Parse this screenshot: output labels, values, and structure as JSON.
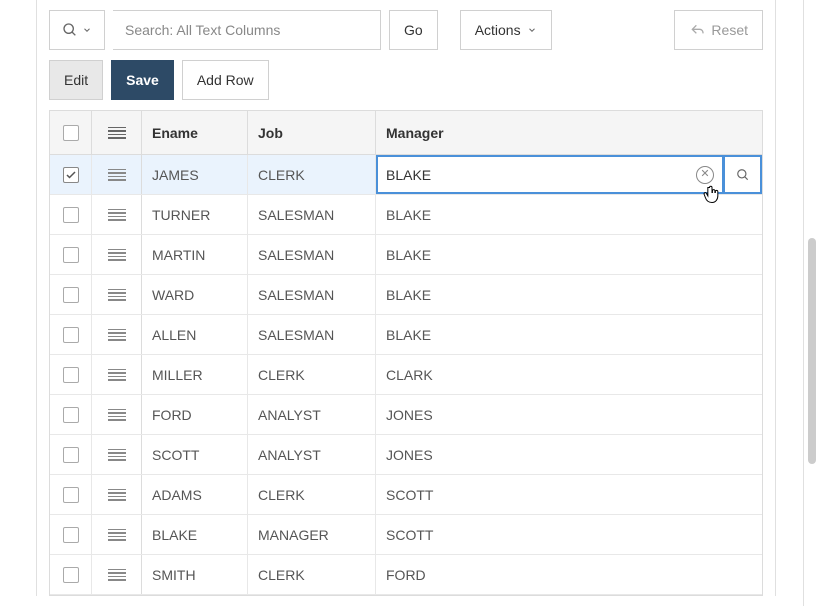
{
  "toolbar": {
    "search_placeholder": "Search: All Text Columns",
    "go_label": "Go",
    "actions_label": "Actions",
    "reset_label": "Reset",
    "edit_label": "Edit",
    "save_label": "Save",
    "add_row_label": "Add Row"
  },
  "columns": {
    "ename": "Ename",
    "job": "Job",
    "manager": "Manager"
  },
  "editor": {
    "value": "BLAKE"
  },
  "rows": [
    {
      "ename": "JAMES",
      "job": "CLERK",
      "manager": "BLAKE",
      "selected": true
    },
    {
      "ename": "TURNER",
      "job": "SALESMAN",
      "manager": "BLAKE",
      "selected": false
    },
    {
      "ename": "MARTIN",
      "job": "SALESMAN",
      "manager": "BLAKE",
      "selected": false
    },
    {
      "ename": "WARD",
      "job": "SALESMAN",
      "manager": "BLAKE",
      "selected": false
    },
    {
      "ename": "ALLEN",
      "job": "SALESMAN",
      "manager": "BLAKE",
      "selected": false
    },
    {
      "ename": "MILLER",
      "job": "CLERK",
      "manager": "CLARK",
      "selected": false
    },
    {
      "ename": "FORD",
      "job": "ANALYST",
      "manager": "JONES",
      "selected": false
    },
    {
      "ename": "SCOTT",
      "job": "ANALYST",
      "manager": "JONES",
      "selected": false
    },
    {
      "ename": "ADAMS",
      "job": "CLERK",
      "manager": "SCOTT",
      "selected": false
    },
    {
      "ename": "BLAKE",
      "job": "MANAGER",
      "manager": "SCOTT",
      "selected": false
    },
    {
      "ename": "SMITH",
      "job": "CLERK",
      "manager": "FORD",
      "selected": false
    }
  ]
}
